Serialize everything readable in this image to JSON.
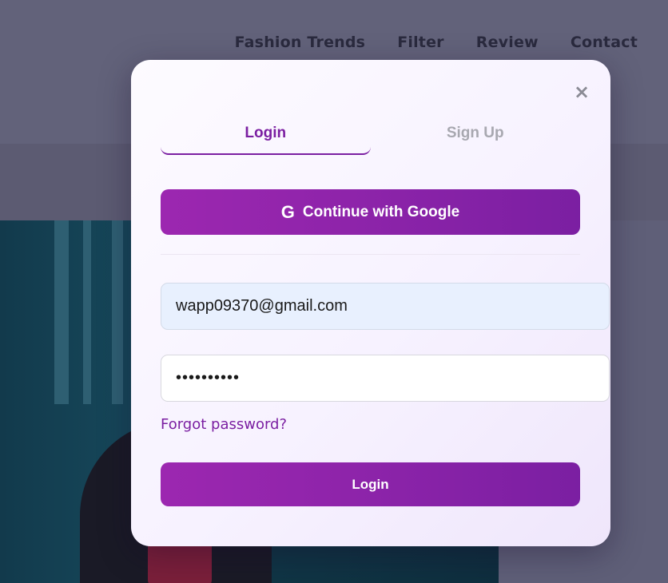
{
  "background": {
    "nav": [
      "Fashion Trends",
      "Filter",
      "Review",
      "Contact"
    ]
  },
  "modal": {
    "close_icon": "×",
    "tabs": {
      "login": "Login",
      "signup": "Sign Up",
      "active": "login"
    },
    "google_button": {
      "icon": "G",
      "label": "Continue with Google"
    },
    "email": {
      "value": "wapp09370@gmail.com",
      "placeholder": ""
    },
    "password": {
      "value": "••••••••••"
    },
    "forgot_link": "Forgot password?",
    "login_button": "Login"
  },
  "colors": {
    "accent": "#7b1fa2",
    "accent_light": "#9c27b0",
    "overlay": "#5f5f78"
  }
}
